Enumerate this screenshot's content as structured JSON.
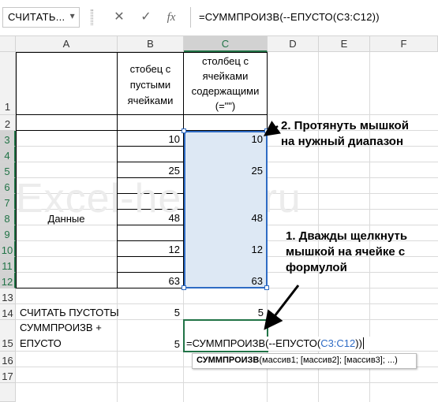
{
  "formula_bar": {
    "name_box": "СЧИТАТЬ...",
    "cancel_icon": "✕",
    "enter_icon": "✓",
    "fx_icon": "fx",
    "formula": "=СУММПРОИЗВ(--ЕПУСТО(C3:C12))"
  },
  "columns": [
    "A",
    "B",
    "C",
    "D",
    "E",
    "F"
  ],
  "rows": [
    "1",
    "2",
    "3",
    "4",
    "5",
    "6",
    "7",
    "8",
    "9",
    "10",
    "11",
    "12",
    "13",
    "14",
    "15",
    "16",
    "17"
  ],
  "cells": {
    "b1": [
      "стобец с",
      "пустыми",
      "ячейками"
    ],
    "c1": [
      "столбец с",
      "ячейками",
      "содержащими",
      "(=\"\")"
    ],
    "a_data": "Данные",
    "b_values": [
      "10",
      "",
      "25",
      "",
      "",
      "48",
      "",
      "12",
      "",
      "63"
    ],
    "c_values": [
      "10",
      "",
      "25",
      "",
      "",
      "48",
      "",
      "12",
      "",
      "63"
    ],
    "a14": "СЧИТАТЬ ПУСТОТЫ",
    "b14": "5",
    "c14": "5",
    "a15": [
      "СУММПРОИЗВ +",
      "ЕПУСТО"
    ],
    "b15": "5",
    "c15_prefix": "=СУММПРОИЗВ(--ЕПУСТО(",
    "c15_ref": "C3:C12",
    "c15_suffix": "))"
  },
  "annotations": {
    "note_drag": [
      "2. Протянуть мышкой",
      "на нужный диапазон"
    ],
    "note_doubleclick": [
      "1. Дважды щелкнуть",
      "мышкой на ячейке с",
      "формулой"
    ]
  },
  "watermark": "Excel-helper.ru",
  "tooltip": {
    "func": "СУММПРОИЗВ",
    "args": "(массив1; [массив2]; [массив3]; ...)"
  },
  "colors": {
    "accent_green": "#217346",
    "selection_fill": "#dde8f4",
    "selection_border": "#2e6bc4",
    "reference_blue": "#2e6bc4"
  }
}
